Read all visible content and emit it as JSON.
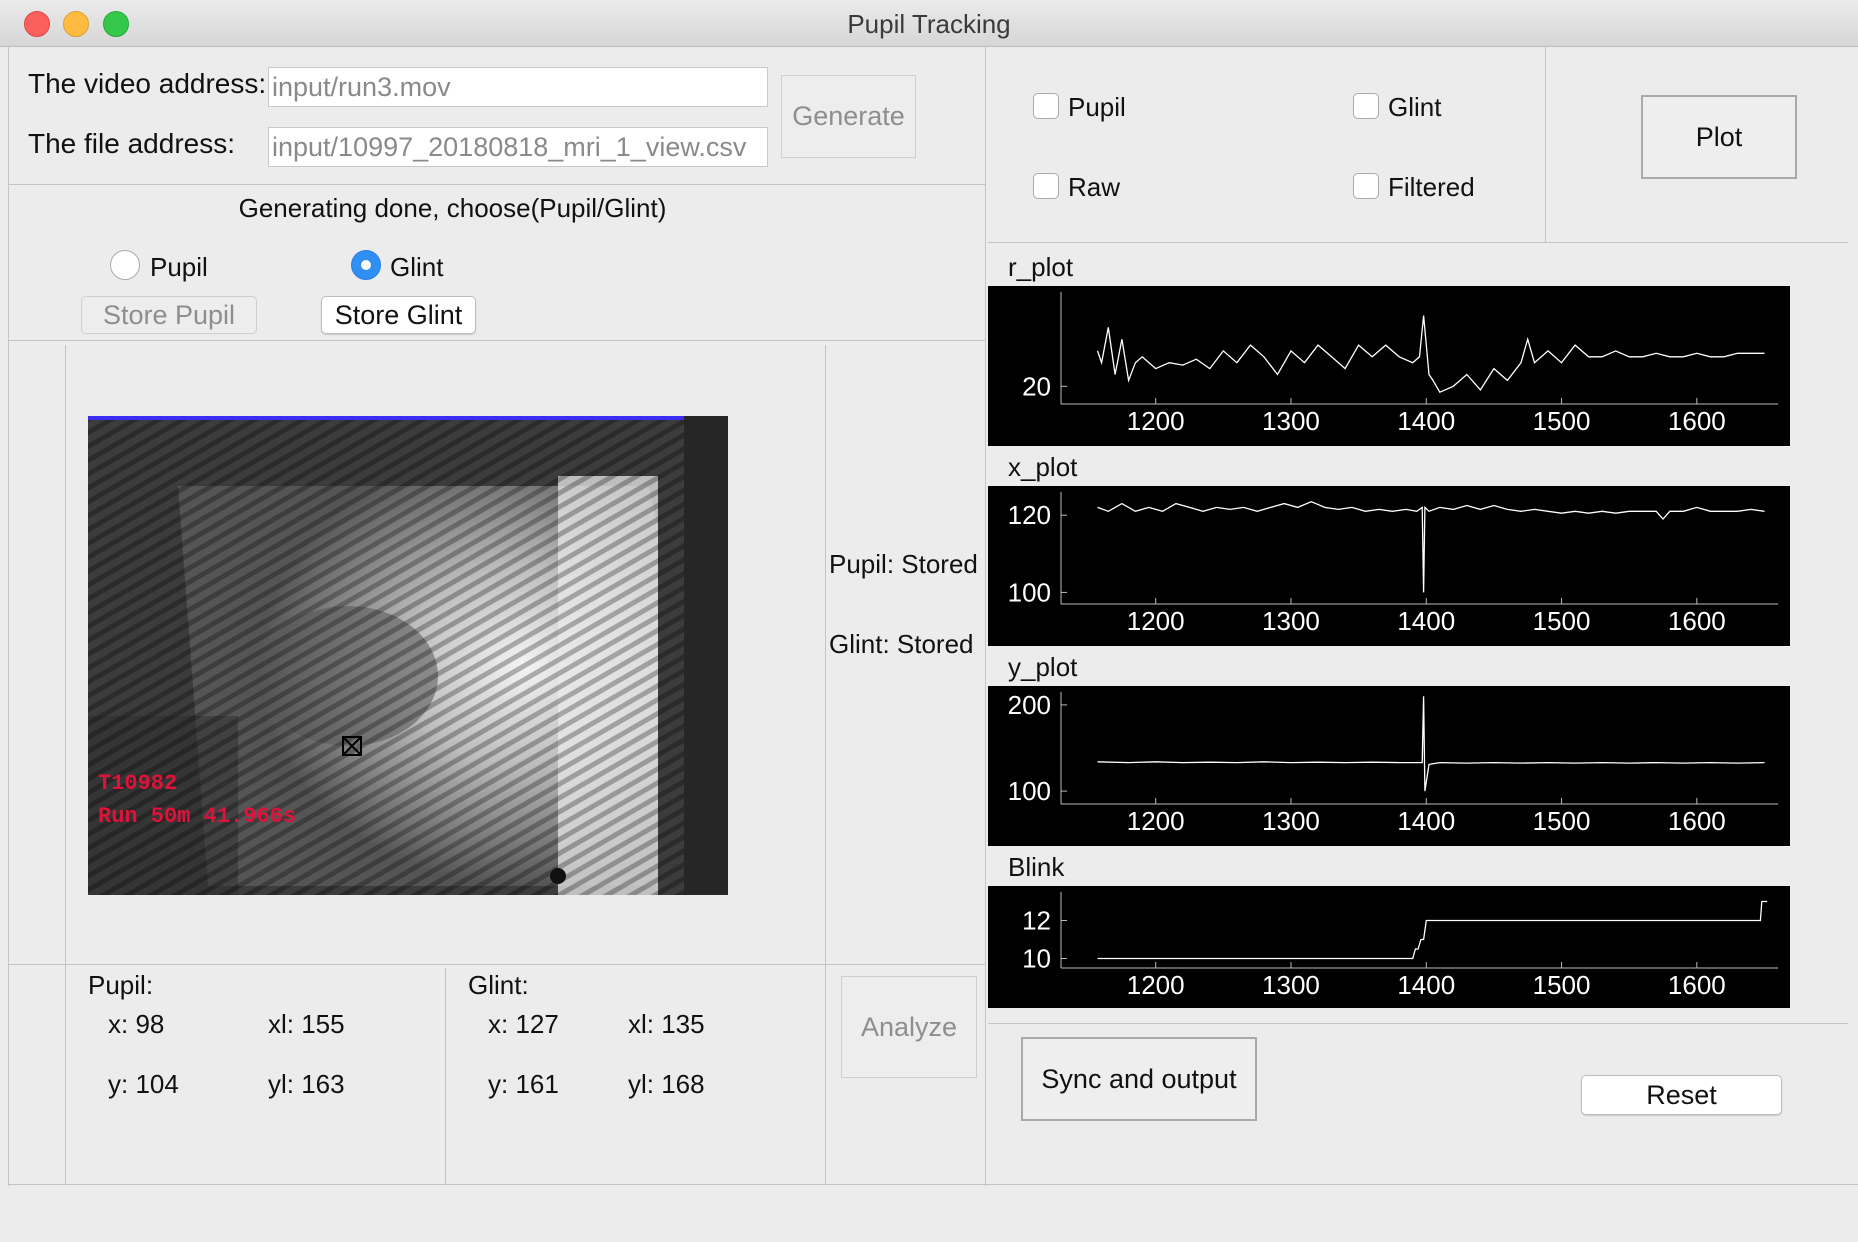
{
  "window": {
    "title": "Pupil Tracking"
  },
  "inputs": {
    "video_label": "The video address:",
    "video_value": "input/run3.mov",
    "file_label": "The file address:",
    "file_value": "input/10997_20180818_mri_1_view.csv",
    "generate_label": "Generate"
  },
  "choose": {
    "status": "Generating done, choose(Pupil/Glint)",
    "radio_pupil": "Pupil",
    "radio_glint": "Glint",
    "selected": "Glint",
    "store_pupil": "Store Pupil",
    "store_glint": "Store Glint"
  },
  "video": {
    "overlay_line1": "T10982",
    "overlay_line2": "Run 50m 41.966s"
  },
  "stored": {
    "pupil": "Pupil: Stored",
    "glint": "Glint: Stored"
  },
  "pupil_coords": {
    "title": "Pupil:",
    "x": "x: 98",
    "xl": "xl: 155",
    "y": "y: 104",
    "yl": "yl: 163"
  },
  "glint_coords": {
    "title": "Glint:",
    "x": "x: 127",
    "xl": "xl: 135",
    "y": "y: 161",
    "yl": "yl: 168"
  },
  "analyze_label": "Analyze",
  "options": {
    "pupil": "Pupil",
    "glint": "Glint",
    "raw": "Raw",
    "filtered": "Filtered",
    "pupil_checked": false,
    "glint_checked": false,
    "raw_checked": false,
    "filtered_checked": false
  },
  "plot_label": "Plot",
  "sync_label": "Sync and output",
  "reset_label": "Reset",
  "colors": {
    "plot_bg": "#000000",
    "trace": "#ffffff",
    "radio_accent": "#2f8ff4",
    "video_blue_edge": "#3a2cf0",
    "overlay_text": "#e0123a"
  },
  "chart_data": [
    {
      "type": "line",
      "title": "r_plot",
      "x_ticks": [
        1200,
        1300,
        1400,
        1500,
        1600
      ],
      "y_ticks": [
        20
      ],
      "xlim": [
        1130,
        1660
      ],
      "ylim": [
        18.5,
        28
      ],
      "series": [
        {
          "x": [
            1157,
            1160,
            1165,
            1170,
            1175,
            1180,
            1185,
            1190,
            1200,
            1210,
            1220,
            1230,
            1240,
            1250,
            1260,
            1270,
            1280,
            1290,
            1300,
            1310,
            1320,
            1330,
            1340,
            1350,
            1360,
            1370,
            1380,
            1390,
            1395,
            1398,
            1402,
            1405,
            1410,
            1420,
            1430,
            1440,
            1450,
            1460,
            1470,
            1475,
            1480,
            1490,
            1500,
            1510,
            1520,
            1530,
            1540,
            1550,
            1560,
            1570,
            1580,
            1590,
            1600,
            1610,
            1620,
            1630,
            1640,
            1650
          ],
          "y": [
            23,
            22,
            25,
            21,
            24,
            20.5,
            22,
            22.5,
            21.5,
            22,
            21.8,
            22.3,
            21.5,
            23,
            22,
            23.5,
            22.5,
            21,
            23,
            22,
            23.5,
            22.5,
            21.5,
            23.5,
            22.5,
            23.5,
            22.5,
            22,
            22.5,
            26,
            21,
            20.5,
            19.5,
            20,
            21,
            19.7,
            21.5,
            20.5,
            22,
            24,
            22,
            23,
            22,
            23.5,
            22.5,
            22.5,
            23,
            22.5,
            22.5,
            22.8,
            22.5,
            22.5,
            22.8,
            22.5,
            22.5,
            22.8,
            22.8,
            22.8
          ]
        }
      ]
    },
    {
      "type": "line",
      "title": "x_plot",
      "x_ticks": [
        1200,
        1300,
        1400,
        1500,
        1600
      ],
      "y_ticks": [
        100,
        120
      ],
      "xlim": [
        1130,
        1660
      ],
      "ylim": [
        97,
        126
      ],
      "series": [
        {
          "x": [
            1157,
            1165,
            1175,
            1185,
            1195,
            1205,
            1215,
            1225,
            1235,
            1245,
            1255,
            1265,
            1275,
            1285,
            1295,
            1305,
            1315,
            1325,
            1335,
            1345,
            1355,
            1365,
            1375,
            1385,
            1393,
            1397,
            1398,
            1399,
            1402,
            1410,
            1420,
            1430,
            1440,
            1450,
            1460,
            1470,
            1480,
            1490,
            1500,
            1510,
            1520,
            1530,
            1540,
            1550,
            1560,
            1570,
            1575,
            1580,
            1590,
            1600,
            1610,
            1620,
            1630,
            1640,
            1650
          ],
          "y": [
            122,
            121,
            123,
            121,
            122,
            121,
            123,
            122,
            121,
            122,
            121.5,
            122,
            121,
            122,
            123,
            122,
            123.5,
            122,
            121.5,
            122,
            121,
            121.5,
            121,
            121.5,
            121,
            122,
            100,
            122,
            121,
            122,
            121.5,
            122.5,
            121.5,
            122.5,
            121.5,
            121,
            121.5,
            121,
            120.5,
            121,
            120.5,
            121,
            120.5,
            121,
            121,
            121,
            119,
            121,
            121,
            122,
            121,
            121,
            121,
            121.5,
            121
          ]
        }
      ]
    },
    {
      "type": "line",
      "title": "y_plot",
      "x_ticks": [
        1200,
        1300,
        1400,
        1500,
        1600
      ],
      "y_ticks": [
        100,
        200
      ],
      "xlim": [
        1130,
        1660
      ],
      "ylim": [
        85,
        215
      ],
      "series": [
        {
          "x": [
            1157,
            1180,
            1200,
            1220,
            1240,
            1260,
            1280,
            1300,
            1320,
            1340,
            1360,
            1380,
            1393,
            1397,
            1398,
            1399,
            1402,
            1410,
            1430,
            1450,
            1470,
            1490,
            1510,
            1530,
            1550,
            1570,
            1590,
            1610,
            1630,
            1650
          ],
          "y": [
            134,
            133,
            134,
            133,
            133.5,
            133,
            134,
            133,
            133.5,
            133,
            133.5,
            133,
            133,
            133,
            210,
            100,
            131,
            133,
            132.5,
            133,
            132.5,
            133,
            132.5,
            133,
            132.5,
            133,
            132.5,
            133,
            132.5,
            133
          ]
        }
      ]
    },
    {
      "type": "line",
      "title": "Blink",
      "x_ticks": [
        1200,
        1300,
        1400,
        1500,
        1600
      ],
      "y_ticks": [
        10,
        12
      ],
      "xlim": [
        1130,
        1660
      ],
      "ylim": [
        9.5,
        13.5
      ],
      "series": [
        {
          "x": [
            1157,
            1390,
            1392,
            1394,
            1396,
            1398,
            1400,
            1647,
            1648,
            1652
          ],
          "y": [
            10,
            10,
            10.5,
            10.5,
            11,
            11,
            12,
            12,
            13,
            13
          ]
        }
      ]
    }
  ]
}
